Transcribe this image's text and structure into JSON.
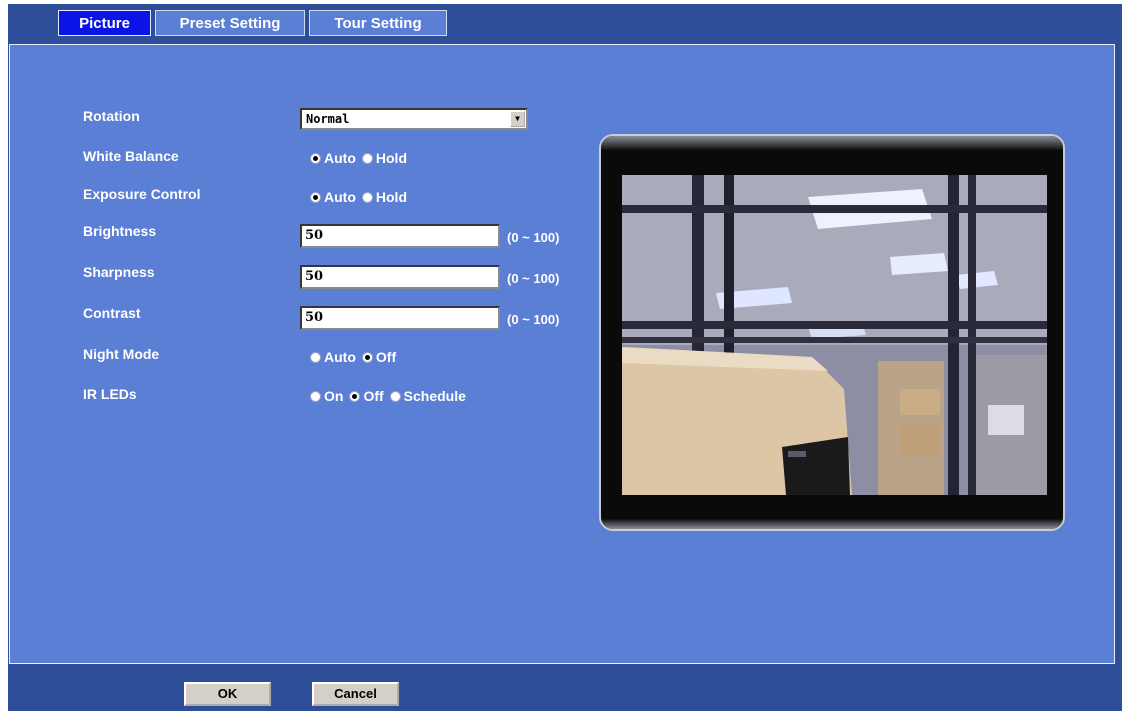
{
  "tabs": [
    {
      "label": "Picture",
      "active": true
    },
    {
      "label": "Preset Setting",
      "active": false
    },
    {
      "label": "Tour Setting",
      "active": false
    }
  ],
  "form": {
    "rotation": {
      "label": "Rotation",
      "value": "Normal"
    },
    "white_balance": {
      "label": "White Balance",
      "options": [
        "Auto",
        "Hold"
      ],
      "selected": "Auto"
    },
    "exposure_control": {
      "label": "Exposure Control",
      "options": [
        "Auto",
        "Hold"
      ],
      "selected": "Auto"
    },
    "brightness": {
      "label": "Brightness",
      "value": "50",
      "range": "(0 ~ 100)"
    },
    "sharpness": {
      "label": "Sharpness",
      "value": "50",
      "range": "(0 ~ 100)"
    },
    "contrast": {
      "label": "Contrast",
      "value": "50",
      "range": "(0 ~ 100)"
    },
    "night_mode": {
      "label": "Night Mode",
      "options": [
        "Auto",
        "Off"
      ],
      "selected": "Off"
    },
    "ir_leds": {
      "label": "IR LEDs",
      "options": [
        "On",
        "Off",
        "Schedule"
      ],
      "selected": "Off"
    }
  },
  "preview": {
    "icon": "camera-live-view"
  },
  "buttons": {
    "ok": "OK",
    "cancel": "Cancel"
  },
  "colors": {
    "panel": "#5b7fd4",
    "frame": "#2f4e9a",
    "active_tab": "#0a14e6"
  }
}
